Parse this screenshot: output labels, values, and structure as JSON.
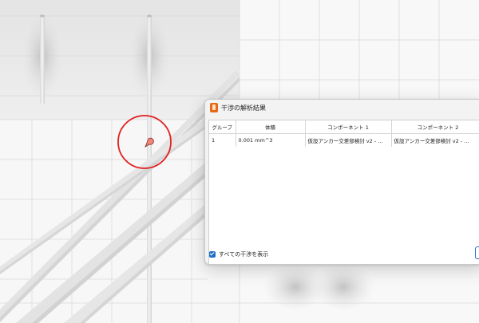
{
  "dialog": {
    "title": "干渉の解析結果",
    "columns": [
      "グループ",
      "体積",
      "コンポーネント 1",
      "コンポーネント 2"
    ],
    "rows": [
      [
        "1",
        "0.001 mm^3",
        "仮設アンカー交差部検討 v2 - ...",
        "仮設アンカー交差部検討 v2 - ..."
      ]
    ],
    "show_all_label": "すべての干渉を表示",
    "show_all_checked": true
  },
  "colors": {
    "highlight_circle": "#e02020",
    "marker_fill": "#f0867a",
    "checkbox_accent": "#1f6fc8"
  }
}
